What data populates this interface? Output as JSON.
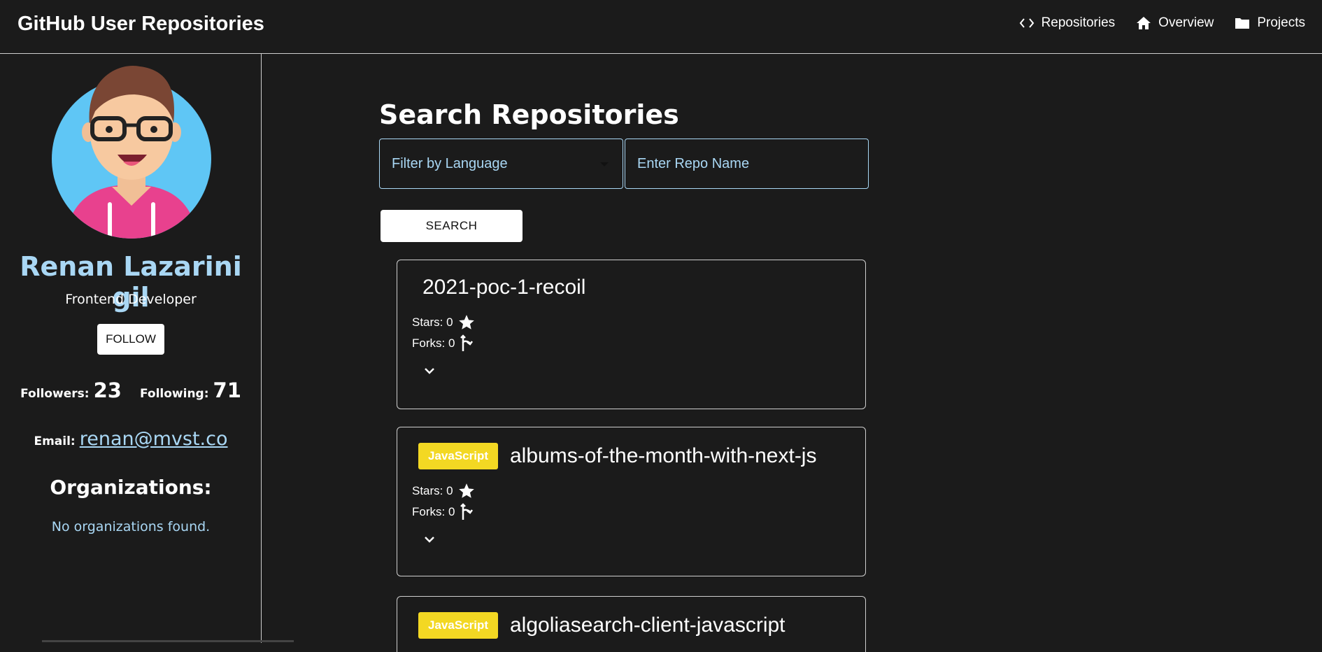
{
  "header": {
    "title": "GitHub User Repositories",
    "nav": [
      {
        "label": "Repositories",
        "icon": "code-icon"
      },
      {
        "label": "Overview",
        "icon": "home-icon"
      },
      {
        "label": "Projects",
        "icon": "folder-icon"
      }
    ]
  },
  "profile": {
    "name": "Renan Lazarini gil",
    "role": "Frontend Developer",
    "follow_label": "FOLLOW",
    "followers_label": "Followers:",
    "followers": "23",
    "following_label": "Following:",
    "following": "71",
    "email_label": "Email:",
    "email": "renan@mvst.co",
    "organizations_title": "Organizations:",
    "organizations_empty": "No organizations found."
  },
  "search": {
    "title": "Search Repositories",
    "language_placeholder": "Filter by Language",
    "name_placeholder": "Enter Repo Name",
    "button_label": "SEARCH"
  },
  "repos": [
    {
      "name": "2021-poc-1-recoil",
      "language": "",
      "stars": "Stars: 0",
      "forks": "Forks: 0"
    },
    {
      "name": "albums-of-the-month-with-next-js",
      "language": "JavaScript",
      "stars": "Stars: 0",
      "forks": "Forks: 0"
    },
    {
      "name": "algoliasearch-client-javascript",
      "language": "JavaScript",
      "stars": "",
      "forks": ""
    }
  ],
  "colors": {
    "background": "#1b1b1b",
    "accent": "#a9d7f4",
    "badge": "#f3d823"
  }
}
